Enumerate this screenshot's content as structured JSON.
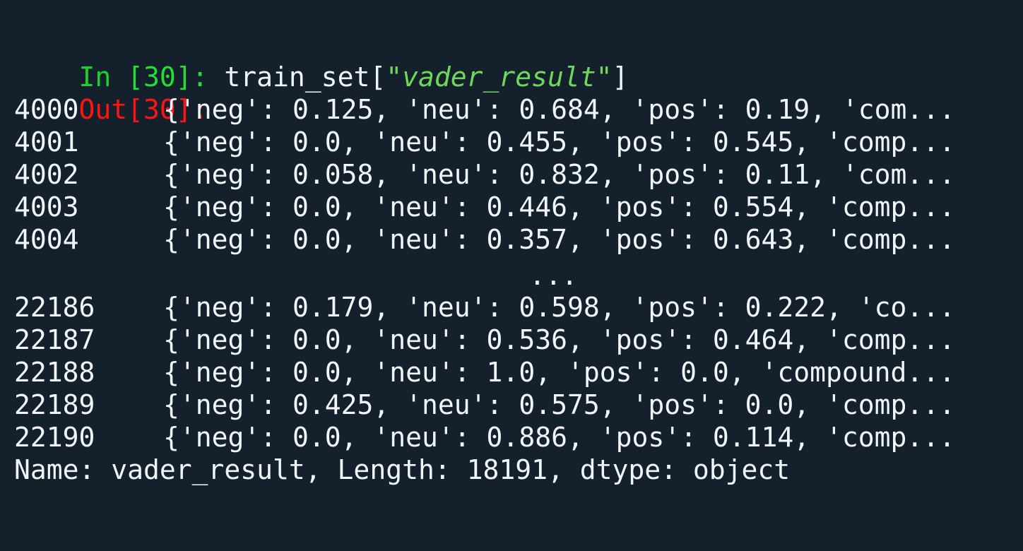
{
  "input": {
    "prompt_label": "In ",
    "prompt_number": "[30]:",
    "code_prefix": " train_set[",
    "code_string": "\"vader_result\"",
    "code_suffix": "]"
  },
  "output": {
    "prompt_label": "Out[30]:"
  },
  "rows": [
    {
      "index": "4000",
      "value": "{'neg': 0.125, 'neu': 0.684, 'pos': 0.19, 'com..."
    },
    {
      "index": "4001",
      "value": "{'neg': 0.0, 'neu': 0.455, 'pos': 0.545, 'comp..."
    },
    {
      "index": "4002",
      "value": "{'neg': 0.058, 'neu': 0.832, 'pos': 0.11, 'com..."
    },
    {
      "index": "4003",
      "value": "{'neg': 0.0, 'neu': 0.446, 'pos': 0.554, 'comp..."
    },
    {
      "index": "4004",
      "value": "{'neg': 0.0, 'neu': 0.357, 'pos': 0.643, 'comp..."
    },
    {
      "index": "22186",
      "value": "{'neg': 0.179, 'neu': 0.598, 'pos': 0.222, 'co..."
    },
    {
      "index": "22187",
      "value": "{'neg': 0.0, 'neu': 0.536, 'pos': 0.464, 'comp..."
    },
    {
      "index": "22188",
      "value": "{'neg': 0.0, 'neu': 1.0, 'pos': 0.0, 'compound..."
    },
    {
      "index": "22189",
      "value": "{'neg': 0.425, 'neu': 0.575, 'pos': 0.0, 'comp..."
    },
    {
      "index": "22190",
      "value": "{'neg': 0.0, 'neu': 0.886, 'pos': 0.114, 'comp..."
    }
  ],
  "ellipsis": "...",
  "footer": "Name: vader_result, Length: 18191, dtype: object",
  "colors": {
    "background": "#14202b",
    "text": "#f2f5f7",
    "input_prompt": "#1fcf2f",
    "output_prompt": "#ff1414",
    "string": "#6fd85b"
  }
}
